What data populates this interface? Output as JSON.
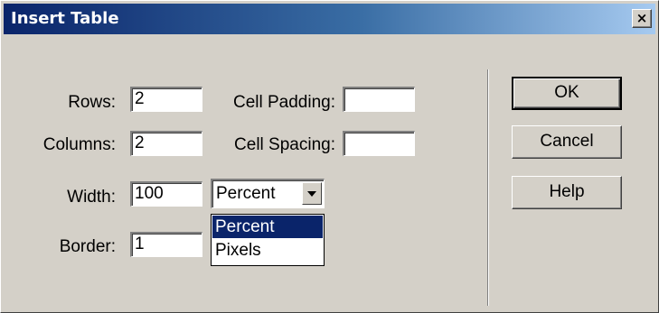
{
  "window": {
    "title": "Insert Table",
    "close_glyph": "×"
  },
  "form": {
    "rows": {
      "label": "Rows:",
      "value": "2"
    },
    "columns": {
      "label": "Columns:",
      "value": "2"
    },
    "width": {
      "label": "Width:",
      "value": "100"
    },
    "border": {
      "label": "Border:",
      "value": "1"
    },
    "cell_padding": {
      "label": "Cell Padding:",
      "value": ""
    },
    "cell_spacing": {
      "label": "Cell Spacing:",
      "value": ""
    },
    "width_unit": {
      "selected": "Percent",
      "options": [
        "Percent",
        "Pixels"
      ],
      "highlighted": "Percent"
    }
  },
  "buttons": {
    "ok": "OK",
    "cancel": "Cancel",
    "help": "Help"
  },
  "colors": {
    "dialog_bg": "#d4d0c8",
    "title_gradient_start": "#0a246a",
    "title_gradient_end": "#a6caf0",
    "selection_bg": "#0a246a"
  },
  "icons": {
    "close": "close-icon",
    "dropdown_arrow": "chevron-down-icon"
  }
}
